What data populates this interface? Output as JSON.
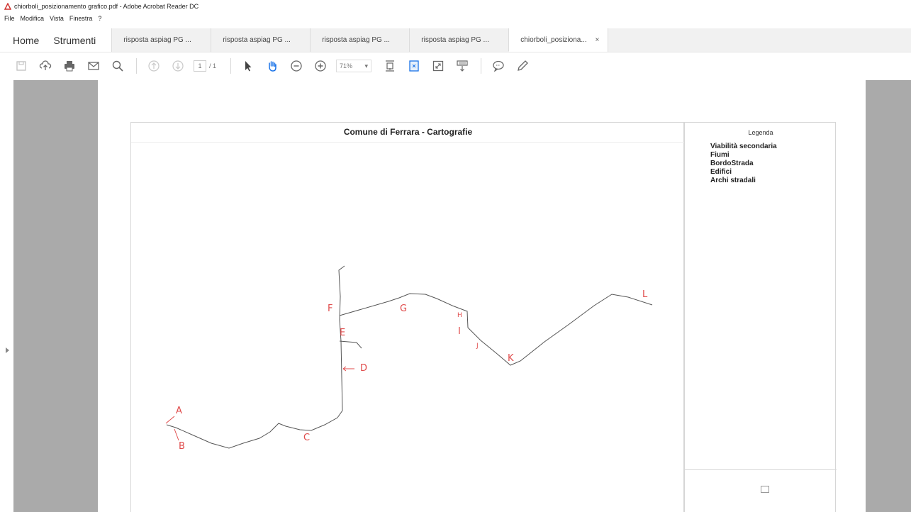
{
  "window": {
    "title": "chiorboli_posizionamento grafico.pdf - Adobe Acrobat Reader DC"
  },
  "menu": [
    "File",
    "Modifica",
    "Vista",
    "Finestra",
    "?"
  ],
  "tabs": {
    "home": "Home",
    "tools": "Strumenti",
    "documents": [
      {
        "label": "risposta aspiag PG ...",
        "active": false
      },
      {
        "label": "risposta aspiag PG ...",
        "active": false
      },
      {
        "label": "risposta aspiag PG ...",
        "active": false
      },
      {
        "label": "risposta aspiag PG ...",
        "active": false
      },
      {
        "label": "chiorboli_posiziona...",
        "active": true,
        "close": "×"
      }
    ]
  },
  "toolbar": {
    "page_current": "1",
    "page_total": "/ 1",
    "zoom": "71%",
    "zoom_caret": "▾",
    "icons": [
      "save-icon",
      "upload-cloud-icon",
      "print-icon",
      "email-icon",
      "search-icon",
      "page-up-icon",
      "page-down-icon",
      "select-arrow-icon",
      "hand-tool-icon",
      "zoom-out-icon",
      "zoom-in-icon",
      "fit-width-icon",
      "fit-page-icon",
      "full-screen-icon",
      "read-mode-icon",
      "comment-icon",
      "pen-icon"
    ]
  },
  "document": {
    "map_title": "Comune di Ferrara - Cartografie",
    "legend": {
      "title": "Legenda",
      "items": [
        "Viabilità secondaria",
        "Fiumi",
        "BordoStrada",
        "Edifici",
        "Archi stradali"
      ]
    },
    "annotations": [
      "A",
      "B",
      "C",
      "D",
      "E",
      "F",
      "G",
      "H",
      "I",
      "J",
      "K",
      "L"
    ],
    "colors": {
      "annotation": "#e04b4b",
      "route": "#555555"
    }
  }
}
